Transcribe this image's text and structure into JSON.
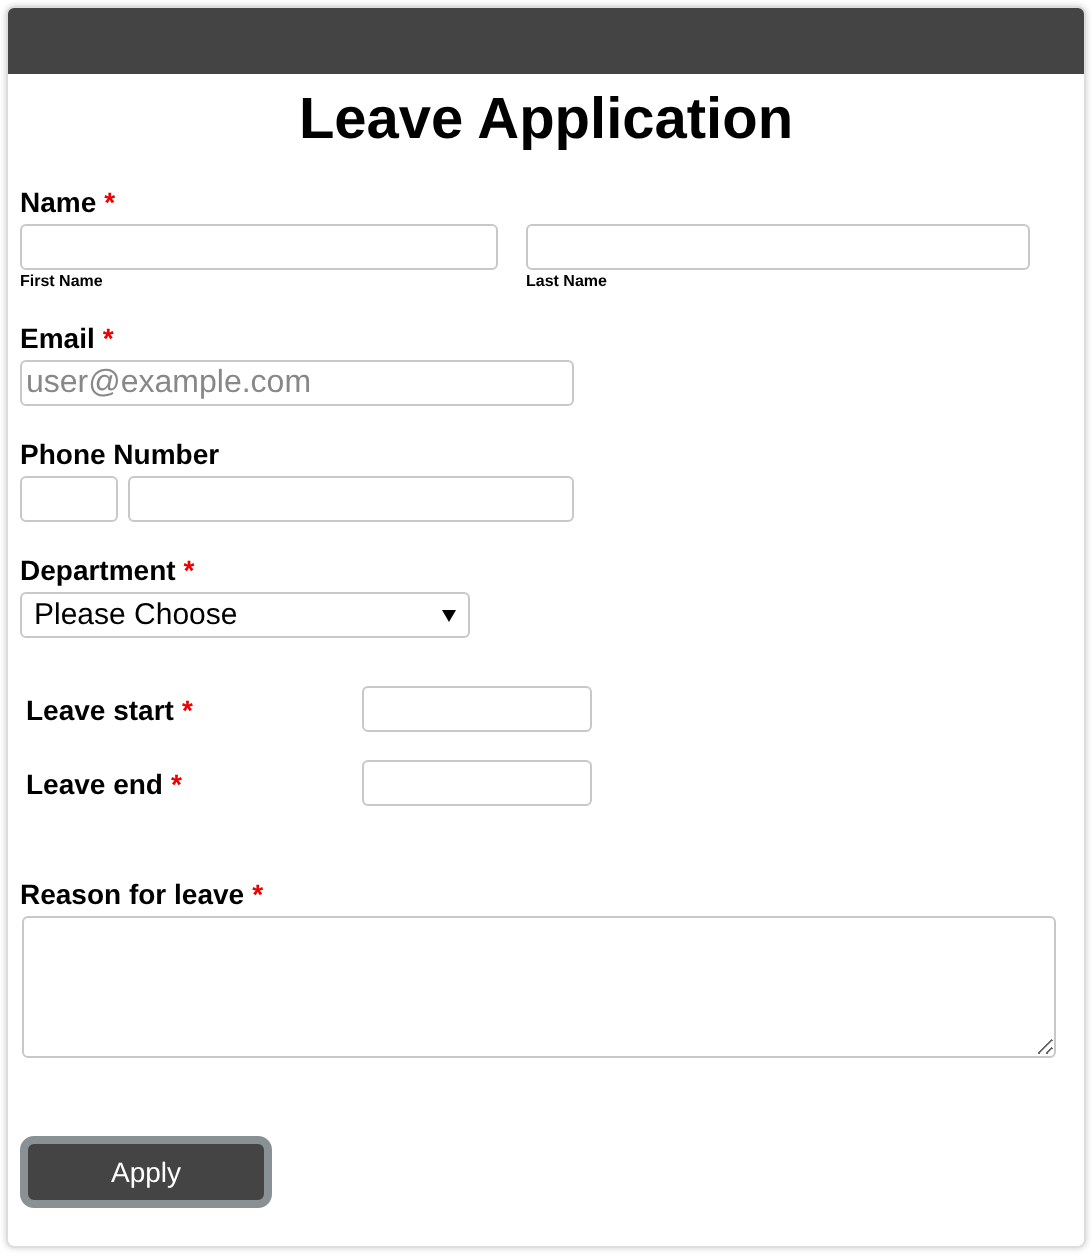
{
  "title": "Leave Application",
  "fields": [
    {
      "kind": "name",
      "label": "Name",
      "required_mark": "*",
      "sublabels": [
        "First Name",
        "Last Name"
      ]
    },
    {
      "kind": "email",
      "label": "Email",
      "required_mark": "*",
      "placeholder": "user@example.com"
    },
    {
      "kind": "phone",
      "label": "Phone Number"
    },
    {
      "kind": "select",
      "label": "Department",
      "required_mark": "*",
      "value": "Please Choose"
    },
    {
      "kind": "date",
      "label": "Leave start",
      "required_mark": "*"
    },
    {
      "kind": "date",
      "label": "Leave end",
      "required_mark": "*"
    },
    {
      "kind": "textarea",
      "label": "Reason for leave",
      "required_mark": "*"
    }
  ],
  "button": "Apply"
}
